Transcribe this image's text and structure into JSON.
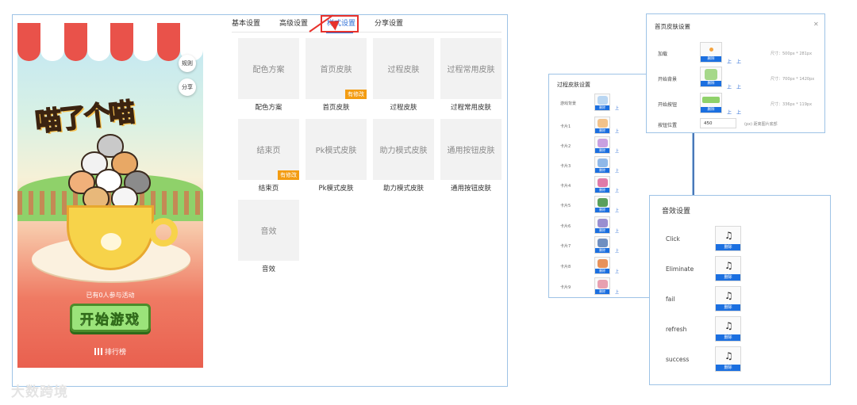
{
  "main": {
    "tabs": [
      {
        "label": "基本设置",
        "active": false
      },
      {
        "label": "高级设置",
        "active": false
      },
      {
        "label": "样式设置",
        "active": true
      },
      {
        "label": "分享设置",
        "active": false
      }
    ],
    "highlight_color": "#e8322c",
    "grid": [
      {
        "thumb": "配色方案",
        "caption": "配色方案",
        "badge": ""
      },
      {
        "thumb": "首页皮肤",
        "caption": "首页皮肤",
        "badge": "有修改"
      },
      {
        "thumb": "过程皮肤",
        "caption": "过程皮肤",
        "badge": ""
      },
      {
        "thumb": "过程常用皮肤",
        "caption": "过程常用皮肤",
        "badge": ""
      },
      {
        "thumb": "结束页",
        "caption": "结束页",
        "badge": "有修改"
      },
      {
        "thumb": "Pk模式皮肤",
        "caption": "Pk模式皮肤",
        "badge": ""
      },
      {
        "thumb": "助力模式皮肤",
        "caption": "助力模式皮肤",
        "badge": ""
      },
      {
        "thumb": "通用按钮皮肤",
        "caption": "通用按钮皮肤",
        "badge": ""
      },
      {
        "thumb": "音效",
        "caption": "音效",
        "badge": ""
      }
    ]
  },
  "preview": {
    "rules_button": "规则",
    "share_button": "分享",
    "logo_text": "喵了个喵",
    "participants": "已有0人参与活动",
    "start_button": "开始游戏",
    "ranking": "排行榜"
  },
  "transition_panel": {
    "title": "过程皮肤设置",
    "rows": [
      {
        "label": "游戏背景",
        "art_color": "#b9d6f2"
      },
      {
        "label": "卡片1",
        "art_color": "#f2c28a"
      },
      {
        "label": "卡片2",
        "art_color": "#c9a0e0"
      },
      {
        "label": "卡片3",
        "art_color": "#8fb8e8"
      },
      {
        "label": "卡片4",
        "art_color": "#e07aa8"
      },
      {
        "label": "卡片5",
        "art_color": "#5aa05a"
      },
      {
        "label": "卡片6",
        "art_color": "#9a8fd0"
      },
      {
        "label": "卡片7",
        "art_color": "#6f8fc0"
      },
      {
        "label": "卡片8",
        "art_color": "#e8925a"
      },
      {
        "label": "卡片9",
        "art_color": "#e8a0b0"
      }
    ],
    "delete_label": "删除",
    "upload_label": "上"
  },
  "home_panel": {
    "title": "首页皮肤设置",
    "close_icon": "close-icon",
    "rows": [
      {
        "label": "加载",
        "size": "尺寸：500px * 281px",
        "art_color": "#f4a340"
      },
      {
        "label": "开始背景",
        "size": "尺寸：700px * 1420px",
        "art_color": "#a6d88a"
      },
      {
        "label": "开始按钮",
        "size": "尺寸：336px * 119px",
        "art_color": "#8fd16a"
      }
    ],
    "button_position_label": "按钮位置",
    "button_position_value": "450",
    "button_position_unit": "(px) 距离图片底部",
    "delete_label": "删除",
    "upload_label": "上"
  },
  "sound_panel": {
    "title": "音效设置",
    "items": [
      {
        "label": "Click"
      },
      {
        "label": "Eliminate"
      },
      {
        "label": "fail"
      },
      {
        "label": "refresh"
      },
      {
        "label": "success"
      }
    ],
    "delete_label": "删除",
    "note_glyph": "♫"
  },
  "watermark": "大数跨境"
}
